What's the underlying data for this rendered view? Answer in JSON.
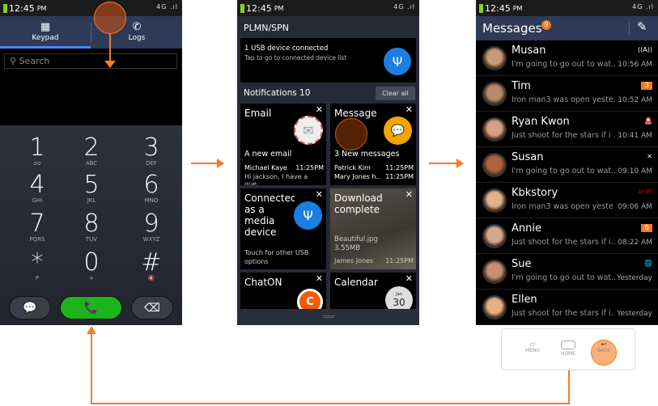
{
  "status": {
    "time": "12:45",
    "ampm": "PM",
    "network": "4G"
  },
  "dialer": {
    "tabs": [
      {
        "label": "Keypad",
        "icon": "keypad-icon"
      },
      {
        "label": "Logs",
        "icon": "call-log-icon"
      }
    ],
    "search_placeholder": "Search",
    "keys": [
      {
        "d": "1",
        "l": "voicemail"
      },
      {
        "d": "2",
        "l": "ABC"
      },
      {
        "d": "3",
        "l": "DEF"
      },
      {
        "d": "4",
        "l": "GHI"
      },
      {
        "d": "5",
        "l": "JKL"
      },
      {
        "d": "6",
        "l": "MNO"
      },
      {
        "d": "7",
        "l": "PQRS"
      },
      {
        "d": "8",
        "l": "TUV"
      },
      {
        "d": "9",
        "l": "WXYZ"
      },
      {
        "d": "*",
        "l": "P"
      },
      {
        "d": "0",
        "l": "+"
      },
      {
        "d": "#",
        "l": "mute"
      }
    ],
    "call_color": "#1db31d"
  },
  "notif": {
    "operator": "PLMN/SPN",
    "usb": {
      "title": "1 USB device connected",
      "sub": "Tap to go to connected device list"
    },
    "header": "Notifications 10",
    "clear": "Clear all",
    "email": {
      "title": "Email",
      "summary": "A new email",
      "sender": "Michael Kaye",
      "time": "11:25PM",
      "preview": "Hi jackson, I have a que..."
    },
    "message": {
      "title": "Message",
      "summary": "3 New messages",
      "s1": "Patrick Kim",
      "t1": "11:25PM",
      "s2": "Mary Jones h..",
      "t2": "11:25PM"
    },
    "media": {
      "title": "Connected as a media device",
      "sub": "Touch for other USB options"
    },
    "download": {
      "title": "Download complete",
      "file": "Beautiful.jpg",
      "size": "3.55MB",
      "sender": "James Jones",
      "time": "11:25PM"
    },
    "chaton": {
      "title": "ChatON"
    },
    "calendar": {
      "title": "Calendar",
      "day": "30",
      "month": "Jan"
    }
  },
  "messages": {
    "title": "Messages",
    "badge": "9",
    "items": [
      {
        "name": "Musan",
        "preview": "I'm going to go out to wat...",
        "time": "10:56 AM",
        "badge": "((A))",
        "badge_type": "icon"
      },
      {
        "name": "Tim",
        "preview": "Iron man3 was open yeste...",
        "time": "10:52 AM",
        "badge": "3",
        "badge_type": "count"
      },
      {
        "name": "Ryan Kwon",
        "preview": "Just shoot for the stars if i ...",
        "time": "10:41 AM",
        "badge": "🚨",
        "badge_type": "icon"
      },
      {
        "name": "Susan",
        "preview": "I'm going to go out to wat...",
        "time": "09:10 AM",
        "badge": "✕",
        "badge_type": "icon"
      },
      {
        "name": "Kbkstory",
        "preview": "Iron man3 was open yeste",
        "time": "09:06 AM",
        "badge": "Draft",
        "badge_type": "draft"
      },
      {
        "name": "Annie",
        "preview": "Just shoot for the stars if i...",
        "time": "08:22 AM",
        "badge": "6",
        "badge_type": "count"
      },
      {
        "name": "Sue",
        "preview": "I'm going to go out to wat...",
        "time": "Yesterday",
        "badge": "🌐",
        "badge_type": "icon"
      },
      {
        "name": "Ellen",
        "preview": "Just shoot for the stars if i...",
        "time": "Yesterday",
        "badge": "",
        "badge_type": "none"
      }
    ]
  },
  "navkeys": {
    "menu": "MENU",
    "home": "HOME",
    "back": "BACK"
  },
  "colors": {
    "accent": "#f47b20",
    "header": "#2e3a58"
  }
}
